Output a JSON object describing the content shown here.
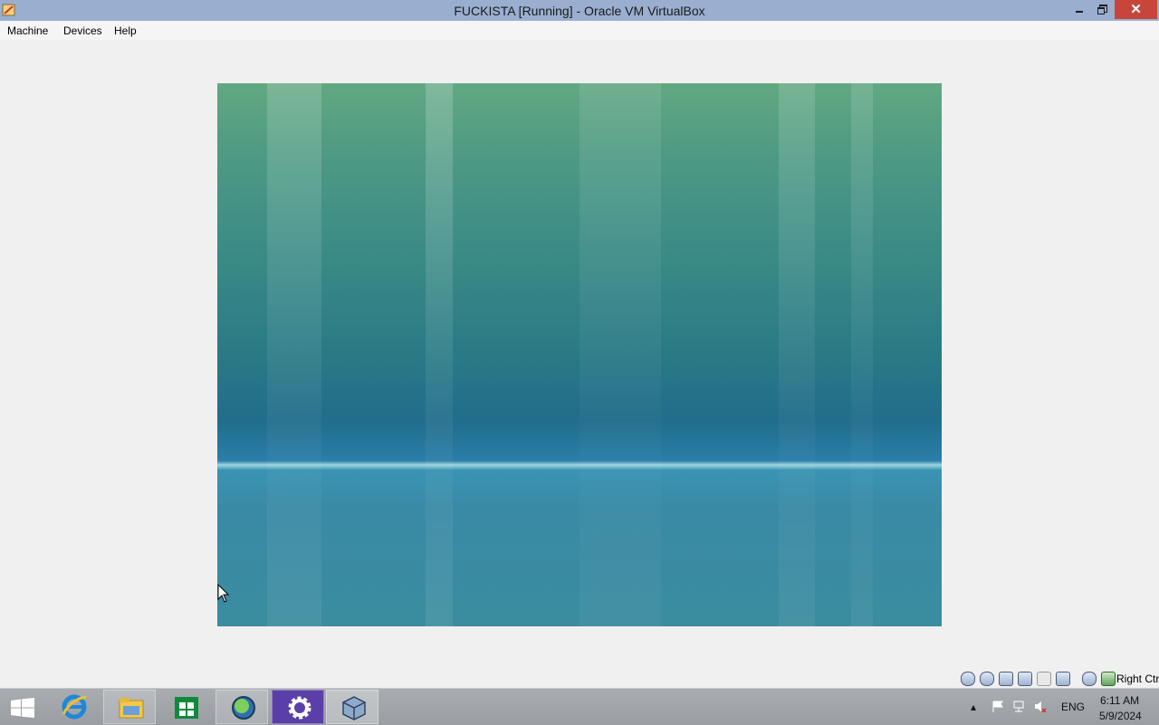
{
  "window": {
    "title": "FUCKISTA [Running] - Oracle VM VirtualBox",
    "app_icon": "virtualbox-icon",
    "controls": {
      "minimize": "minimize-icon",
      "restore": "restore-icon",
      "close": "close-icon",
      "close_glyph": "✕"
    }
  },
  "menubar": {
    "items": [
      {
        "label": "Machine"
      },
      {
        "label": "Devices"
      },
      {
        "label": "Help"
      }
    ]
  },
  "vm": {
    "state": "Running",
    "screen": "vista-wallpaper"
  },
  "statusbar": {
    "icons": [
      "hard-disk-icon",
      "optical-drive-icon",
      "audio-icon",
      "network-icon",
      "shared-folders-icon",
      "video-capture-icon",
      "mouse-integration-icon",
      "host-key-icon"
    ],
    "host_key": "Right Ctrl"
  },
  "taskbar": {
    "pinned": [
      {
        "name": "internet-explorer"
      },
      {
        "name": "file-explorer"
      },
      {
        "name": "windows-store"
      },
      {
        "name": "network-app"
      },
      {
        "name": "settings"
      },
      {
        "name": "virtualbox",
        "active": true
      }
    ],
    "tray": {
      "language": "ENG",
      "time": "6:11 AM",
      "date": "5/9/2024"
    }
  },
  "colors": {
    "titlebar": "#9aaed0",
    "close_button": "#c7453a",
    "taskbar": "#9ea2a6"
  }
}
